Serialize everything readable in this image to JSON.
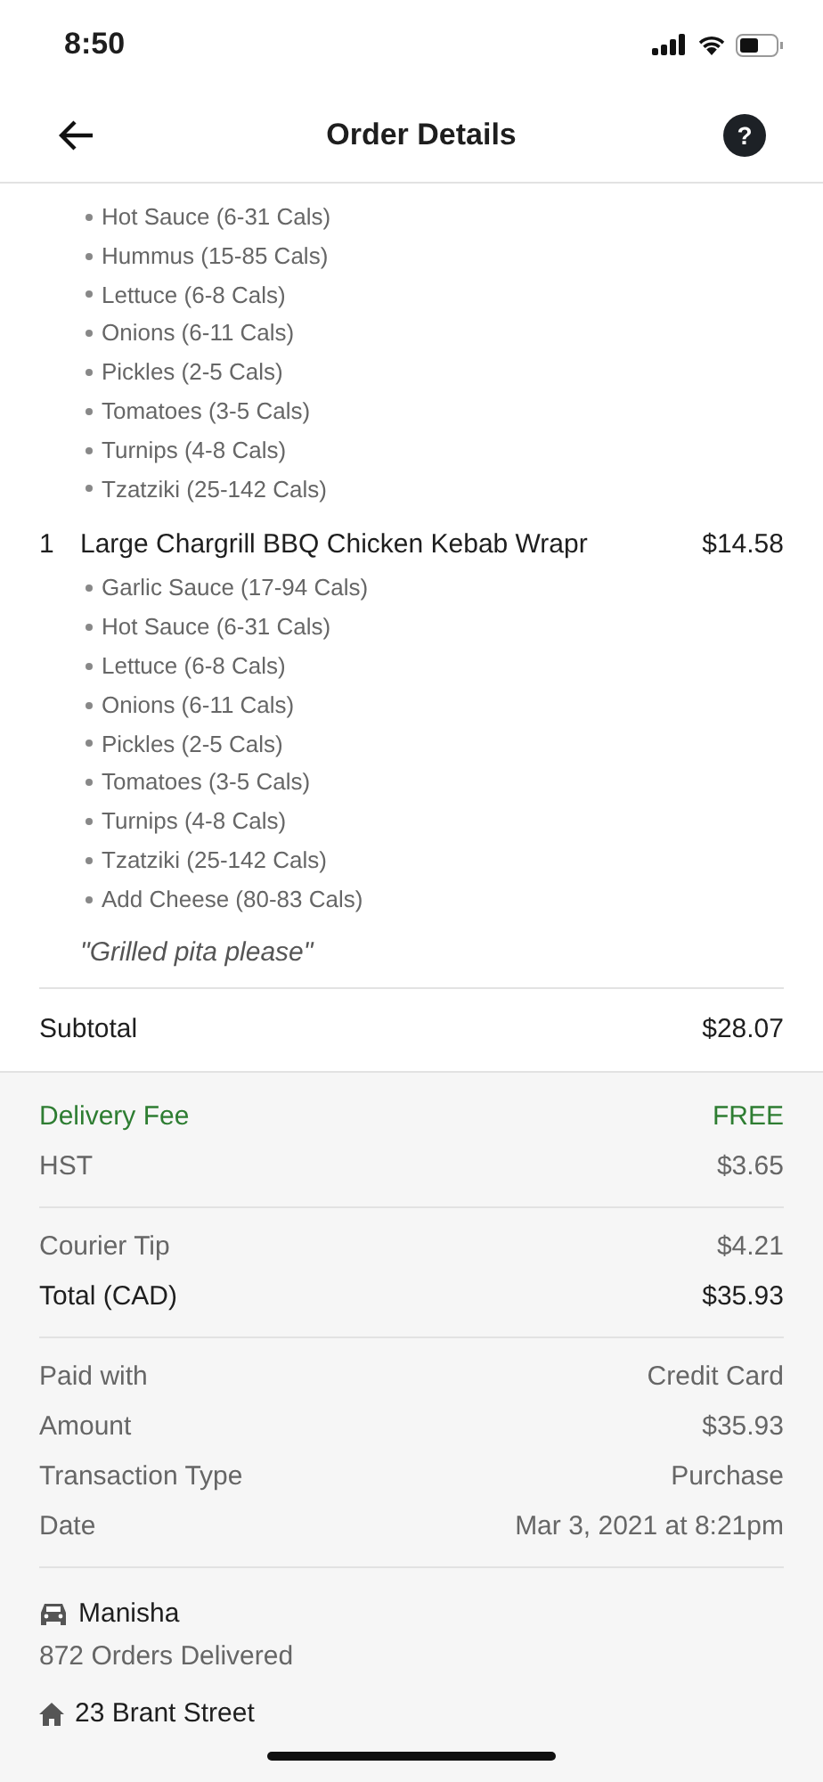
{
  "status_bar": {
    "time": "8:50"
  },
  "header": {
    "title": "Order Details",
    "help": "?"
  },
  "items": [
    {
      "options": [
        "Hot Sauce (6-31 Cals)",
        "Hummus (15-85 Cals)",
        "Lettuce (6-8 Cals)",
        "Onions (6-11 Cals)",
        "Pickles (2-5 Cals)",
        "Tomatoes (3-5 Cals)",
        "Turnips (4-8 Cals)",
        "Tzatziki (25-142 Cals)"
      ]
    },
    {
      "quantity": "1",
      "name": "Large Chargrill BBQ Chicken Kebab Wrapr",
      "price": "$14.58",
      "options": [
        "Garlic Sauce (17-94 Cals)",
        "Hot Sauce (6-31 Cals)",
        "Lettuce (6-8 Cals)",
        "Onions (6-11 Cals)",
        "Pickles (2-5 Cals)",
        "Tomatoes (3-5 Cals)",
        "Turnips (4-8 Cals)",
        "Tzatziki (25-142 Cals)",
        "Add Cheese (80-83 Cals)"
      ],
      "note": "\"Grilled pita please\""
    }
  ],
  "subtotal": {
    "label": "Subtotal",
    "value": "$28.07"
  },
  "fees": [
    {
      "label": "Delivery Fee",
      "value": "FREE",
      "kind": "highlight"
    },
    {
      "label": "HST",
      "value": "$3.65",
      "kind": "plain"
    }
  ],
  "totals": [
    {
      "label": "Courier Tip",
      "value": "$4.21",
      "kind": "plain"
    },
    {
      "label": "Total (CAD)",
      "value": "$35.93",
      "kind": "strong"
    }
  ],
  "payment": [
    {
      "label": "Paid with",
      "value": "Credit Card"
    },
    {
      "label": "Amount",
      "value": "$35.93"
    },
    {
      "label": "Transaction Type",
      "value": "Purchase"
    },
    {
      "label": "Date",
      "value": "Mar 3, 2021 at 8:21pm"
    }
  ],
  "courier": {
    "name": "Manisha",
    "orders": "872 Orders Delivered"
  },
  "address": "23 Brant Street"
}
